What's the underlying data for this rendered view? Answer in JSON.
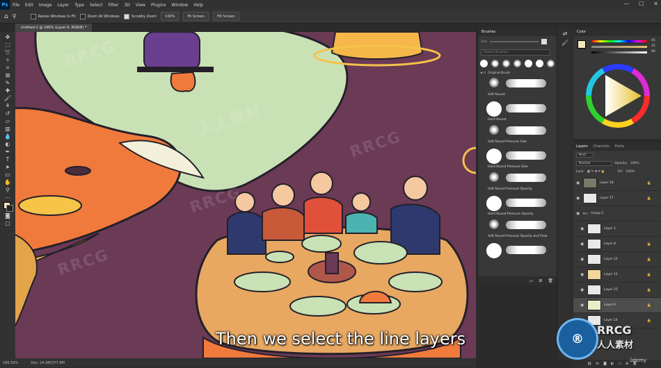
{
  "app": {
    "logo": "Ps"
  },
  "menu": [
    "File",
    "Edit",
    "Image",
    "Layer",
    "Type",
    "Select",
    "Filter",
    "3D",
    "View",
    "Plugins",
    "Window",
    "Help"
  ],
  "window_controls": {
    "minimize": "—",
    "maximize": "☐",
    "close": "✕"
  },
  "options_bar": {
    "resize_windows": "Resize Windows to Fit",
    "zoom_all": "Zoom All Windows",
    "scrubby_zoom": "Scrubby Zoom",
    "zoom_100": "100%",
    "fit_screen": "Fit Screen",
    "fill_screen": "Fill Screen"
  },
  "document_tab": "Untitled-1 @ 166% (Layer 6, RGB/8) *",
  "status_bar": {
    "zoom": "166.56%",
    "doc": "Doc: 24.9M/377.8M"
  },
  "subtitle": "Then we select the line layers",
  "watermarks": [
    "RRCG",
    "人人素材"
  ],
  "brushes": {
    "title": "Brushes",
    "size_label": "Size",
    "search_placeholder": "Search Brushes",
    "group": "Original Brush",
    "items": [
      "Soft Round",
      "Hard Round",
      "Soft Round Pressure Size",
      "Hard Round Pressure Size",
      "Soft Round Pressure Opacity",
      "Hard Round Pressure Opacity",
      "Soft Round Pressure Opacity and Flow"
    ]
  },
  "color_panel": {
    "title": "Color",
    "values": [
      "45",
      "35",
      "98"
    ]
  },
  "layers_panel": {
    "tabs": [
      "Layers",
      "Channels",
      "Paths"
    ],
    "kind": "Kind",
    "blend_mode": "Normal",
    "opacity_label": "Opacity:",
    "opacity": "100%",
    "lock_label": "Lock:",
    "fill_label": "Fill:",
    "fill": "100%",
    "layers": [
      "Layer 18",
      "Layer 17",
      "Group 2",
      "Layer 1",
      "Layer 8",
      "Layer 12",
      "Layer 11",
      "Layer 15",
      "Layer 6",
      "Layer 14"
    ],
    "selected": "Layer 6"
  },
  "brand": {
    "line1": "RRCG",
    "line2": "人人素材"
  },
  "udemy": "ûdemy",
  "colors": {
    "accent": "#31a8ff",
    "canvas_bg": "#6b3a55",
    "panel": "#383838"
  }
}
